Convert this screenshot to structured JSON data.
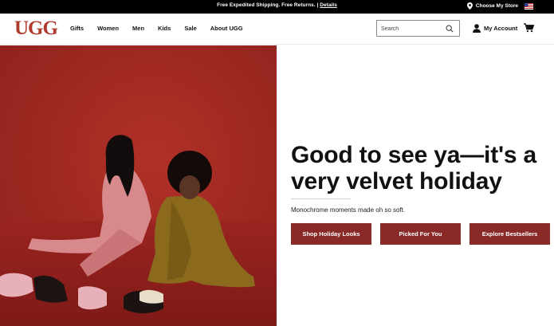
{
  "promo": {
    "text": "Free Expedited Shipping. Free Returns. | ",
    "details_link": "Details",
    "store_link": "Choose My Store",
    "store_icon": "map-pin-icon",
    "flag_icon": "us-flag-icon"
  },
  "header": {
    "logo": "UGG",
    "nav": [
      "Gifts",
      "Women",
      "Men",
      "Kids",
      "Sale",
      "About UGG"
    ],
    "search": {
      "placeholder": "Search",
      "value": "",
      "icon": "search-icon"
    },
    "account_label": "My Account",
    "account_icon": "user-icon",
    "cart_icon": "cart-icon"
  },
  "hero": {
    "headline_line1": "Good to see ya—it's a",
    "headline_line2": "very velvet holiday",
    "subtext": "Monochrome moments made oh so soft.",
    "ctas": [
      "Shop Holiday Looks",
      "Picked For You",
      "Explore Bestsellers"
    ]
  },
  "colors": {
    "brand_red": "#b03a2e",
    "cta_bg": "#8a2a28",
    "hero_bg": "#9c2521",
    "promo_bg": "#000000"
  }
}
